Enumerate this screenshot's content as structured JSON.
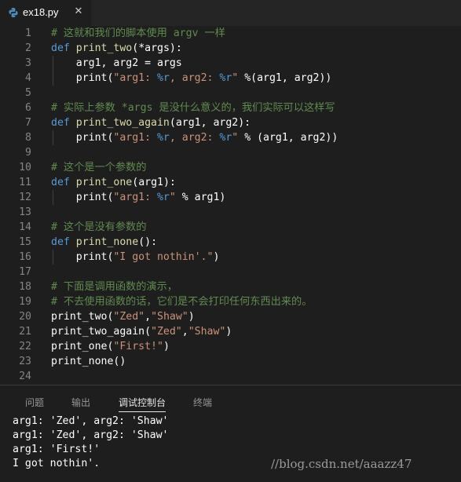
{
  "tab": {
    "filename": "ex18.py",
    "close_glyph": "✕",
    "icon": "python-icon"
  },
  "code_lines": [
    {
      "n": "1",
      "t": [
        [
          "com",
          "# 这就和我们的脚本使用 argv 一样"
        ]
      ]
    },
    {
      "n": "2",
      "t": [
        [
          "kw",
          "def"
        ],
        [
          "txt",
          " "
        ],
        [
          "fn",
          "print_two"
        ],
        [
          "txt",
          "(*args):"
        ]
      ]
    },
    {
      "n": "3",
      "t": [
        [
          "txt",
          "    arg1, arg2 = args"
        ]
      ]
    },
    {
      "n": "4",
      "t": [
        [
          "txt",
          "    print("
        ],
        [
          "str",
          "\"arg1: "
        ],
        [
          "fmt",
          "%r"
        ],
        [
          "str",
          ", arg2: "
        ],
        [
          "fmt",
          "%r"
        ],
        [
          "str",
          "\""
        ],
        [
          "txt",
          " %(arg1, arg2))"
        ]
      ]
    },
    {
      "n": "5",
      "t": []
    },
    {
      "n": "6",
      "t": [
        [
          "com",
          "# 实际上参数 *args 是没什么意义的，我们实际可以这样写"
        ]
      ]
    },
    {
      "n": "7",
      "t": [
        [
          "kw",
          "def"
        ],
        [
          "txt",
          " "
        ],
        [
          "fn",
          "print_two_again"
        ],
        [
          "txt",
          "(arg1, arg2):"
        ]
      ]
    },
    {
      "n": "8",
      "t": [
        [
          "txt",
          "    print("
        ],
        [
          "str",
          "\"arg1: "
        ],
        [
          "fmt",
          "%r"
        ],
        [
          "str",
          ", arg2: "
        ],
        [
          "fmt",
          "%r"
        ],
        [
          "str",
          "\""
        ],
        [
          "txt",
          " % (arg1, arg2))"
        ]
      ]
    },
    {
      "n": "9",
      "t": []
    },
    {
      "n": "10",
      "t": [
        [
          "com",
          "# 这个是一个参数的"
        ]
      ]
    },
    {
      "n": "11",
      "t": [
        [
          "kw",
          "def"
        ],
        [
          "txt",
          " "
        ],
        [
          "fn",
          "print_one"
        ],
        [
          "txt",
          "(arg1):"
        ]
      ]
    },
    {
      "n": "12",
      "t": [
        [
          "txt",
          "    print("
        ],
        [
          "str",
          "\"arg1: "
        ],
        [
          "fmt",
          "%r"
        ],
        [
          "str",
          "\""
        ],
        [
          "txt",
          " % arg1)"
        ]
      ]
    },
    {
      "n": "13",
      "t": []
    },
    {
      "n": "14",
      "t": [
        [
          "com",
          "# 这个是没有参数的"
        ]
      ]
    },
    {
      "n": "15",
      "t": [
        [
          "kw",
          "def"
        ],
        [
          "txt",
          " "
        ],
        [
          "fn",
          "print_none"
        ],
        [
          "txt",
          "():"
        ]
      ]
    },
    {
      "n": "16",
      "t": [
        [
          "txt",
          "    print("
        ],
        [
          "str",
          "\"I got nothin'.\""
        ],
        [
          "txt",
          ")"
        ]
      ]
    },
    {
      "n": "17",
      "t": []
    },
    {
      "n": "18",
      "t": [
        [
          "com",
          "# 下面是调用函数的演示，"
        ]
      ]
    },
    {
      "n": "19",
      "t": [
        [
          "com",
          "# 不去使用函数的话，它们是不会打印任何东西出来的。"
        ]
      ]
    },
    {
      "n": "20",
      "t": [
        [
          "txt",
          "print_two("
        ],
        [
          "str",
          "\"Zed\""
        ],
        [
          "txt",
          ","
        ],
        [
          "str",
          "\"Shaw\""
        ],
        [
          "txt",
          ")"
        ]
      ]
    },
    {
      "n": "21",
      "t": [
        [
          "txt",
          "print_two_again("
        ],
        [
          "str",
          "\"Zed\""
        ],
        [
          "txt",
          ","
        ],
        [
          "str",
          "\"Shaw\""
        ],
        [
          "txt",
          ")"
        ]
      ]
    },
    {
      "n": "22",
      "t": [
        [
          "txt",
          "print_one("
        ],
        [
          "str",
          "\"First!\""
        ],
        [
          "txt",
          ")"
        ]
      ]
    },
    {
      "n": "23",
      "t": [
        [
          "txt",
          "print_none()"
        ]
      ]
    },
    {
      "n": "24",
      "t": []
    }
  ],
  "panel": {
    "tabs": [
      "问题",
      "输出",
      "调试控制台",
      "终端"
    ],
    "active_tab": "调试控制台",
    "output": [
      "arg1: 'Zed', arg2: 'Shaw'",
      "arg1: 'Zed', arg2: 'Shaw'",
      "arg1: 'First!'",
      "I got nothin'."
    ]
  },
  "watermark": "//blog.csdn.net/aaazz47",
  "colors": {
    "background": "#1e1e1e",
    "comment": "#608b4e",
    "keyword": "#569cd6",
    "function": "#dcdcaa",
    "string": "#ce9178"
  }
}
